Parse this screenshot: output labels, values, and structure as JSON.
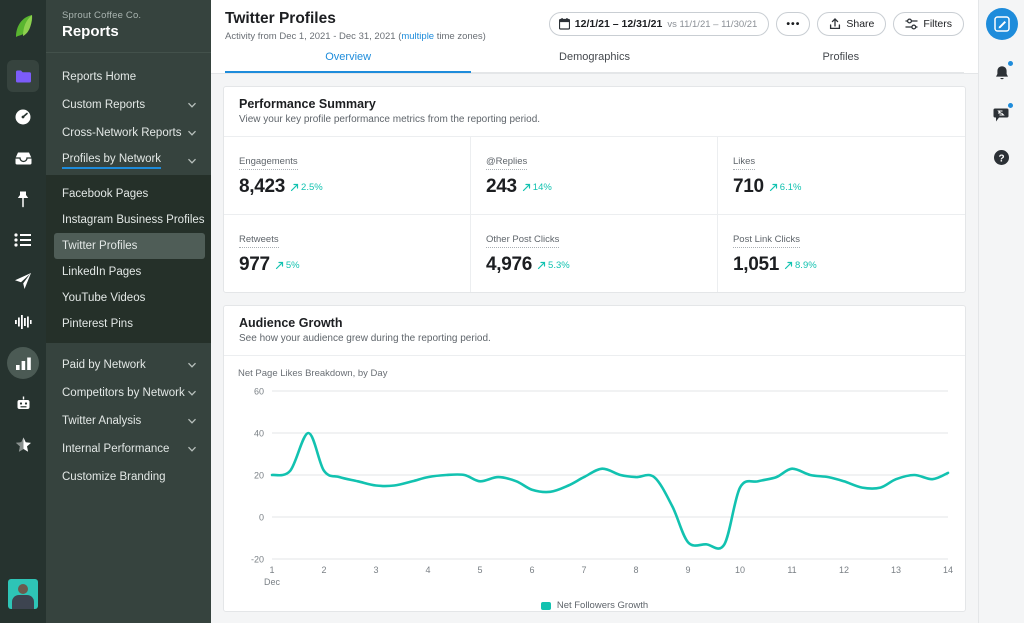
{
  "rail": {
    "logo": "sprout-leaf-logo",
    "icons": [
      {
        "name": "folder-icon",
        "state": "boxed"
      },
      {
        "name": "speedometer-icon",
        "state": "plain"
      },
      {
        "name": "inbox-icon",
        "state": "plain"
      },
      {
        "name": "pin-icon",
        "state": "plain"
      },
      {
        "name": "list-icon",
        "state": "plain"
      },
      {
        "name": "paper-plane-icon",
        "state": "plain"
      },
      {
        "name": "audio-wave-icon",
        "state": "plain"
      },
      {
        "name": "bar-chart-icon",
        "state": "active"
      },
      {
        "name": "robot-icon",
        "state": "plain"
      },
      {
        "name": "star-icon",
        "state": "plain"
      }
    ],
    "avatar": "user-avatar"
  },
  "sidebar": {
    "org": "Sprout Coffee Co.",
    "title": "Reports",
    "items": [
      {
        "label": "Reports Home",
        "expandable": false,
        "active": false
      },
      {
        "label": "Custom Reports",
        "expandable": true,
        "active": false
      },
      {
        "label": "Cross-Network Reports",
        "expandable": true,
        "active": false
      },
      {
        "label": "Profiles by Network",
        "expandable": true,
        "active": true
      }
    ],
    "sub_items": [
      {
        "label": "Facebook Pages",
        "selected": false
      },
      {
        "label": "Instagram Business Profiles",
        "selected": false
      },
      {
        "label": "Twitter Profiles",
        "selected": true
      },
      {
        "label": "LinkedIn Pages",
        "selected": false
      },
      {
        "label": "YouTube Videos",
        "selected": false
      },
      {
        "label": "Pinterest Pins",
        "selected": false
      }
    ],
    "group_items": [
      {
        "label": "Paid by Network",
        "expandable": true
      },
      {
        "label": "Competitors by Network",
        "expandable": true
      },
      {
        "label": "Twitter Analysis",
        "expandable": true
      },
      {
        "label": "Internal Performance",
        "expandable": true
      },
      {
        "label": "Customize Branding",
        "expandable": false
      }
    ]
  },
  "header": {
    "title": "Twitter Profiles",
    "subtitle_prefix": "Activity from Dec 1, 2021 - Dec 31, 2021 (",
    "subtitle_link": "multiple",
    "subtitle_suffix": " time zones)",
    "date_range": "12/1/21 – 12/31/21",
    "date_compare": "vs 11/1/21 – 11/30/21",
    "more_label": "•••",
    "share_label": "Share",
    "filters_label": "Filters"
  },
  "tabs": [
    {
      "label": "Overview",
      "active": true
    },
    {
      "label": "Demographics",
      "active": false
    },
    {
      "label": "Profiles",
      "active": false
    }
  ],
  "performance": {
    "title": "Performance Summary",
    "description": "View your key profile performance metrics from the reporting period.",
    "metrics": [
      {
        "label": "Engagements",
        "value": "8,423",
        "delta": "2.5%",
        "direction": "up"
      },
      {
        "label": "@Replies",
        "value": "243",
        "delta": "14%",
        "direction": "up"
      },
      {
        "label": "Likes",
        "value": "710",
        "delta": "6.1%",
        "direction": "up"
      },
      {
        "label": "Retweets",
        "value": "977",
        "delta": "5%",
        "direction": "up"
      },
      {
        "label": "Other Post Clicks",
        "value": "4,976",
        "delta": "5.3%",
        "direction": "up"
      },
      {
        "label": "Post Link Clicks",
        "value": "1,051",
        "delta": "8.9%",
        "direction": "up"
      }
    ]
  },
  "audience": {
    "title": "Audience Growth",
    "description": "See how your audience grew during the reporting period.",
    "chart_label": "Net Page Likes Breakdown, by Day"
  },
  "chart_data": {
    "type": "line",
    "title": "Net Page Likes Breakdown, by Day",
    "xlabel": "Dec",
    "ylabel": "",
    "color": "#12c2b0",
    "grid": true,
    "legend_position": "bottom",
    "ylim": [
      -20,
      60
    ],
    "yticks": [
      60,
      40,
      20,
      0,
      -20
    ],
    "xticks": [
      "1",
      "2",
      "3",
      "4",
      "5",
      "6",
      "7",
      "8",
      "9",
      "10",
      "11",
      "12",
      "13",
      "14"
    ],
    "x_axis_note": "Dec",
    "series": [
      {
        "name": "Net Followers Growth",
        "x": [
          1,
          1.35,
          1.7,
          2,
          2.3,
          2.65,
          3,
          3.35,
          3.7,
          4,
          4.35,
          4.7,
          5,
          5.35,
          5.7,
          6,
          6.35,
          6.7,
          7,
          7.35,
          7.7,
          8,
          8.35,
          8.7,
          9,
          9.35,
          9.7,
          10,
          10.35,
          10.7,
          11,
          11.35,
          11.7,
          12,
          12.35,
          12.7,
          13,
          13.35,
          13.7,
          14
        ],
        "values": [
          20,
          22,
          40,
          22,
          19,
          17,
          15,
          15,
          17,
          19,
          20,
          20,
          17,
          19,
          17,
          13,
          12,
          15,
          19,
          23,
          20,
          19,
          19,
          5,
          -12,
          -13,
          -13,
          14,
          17,
          19,
          23,
          20,
          19,
          17,
          14,
          14,
          18,
          20,
          18,
          21
        ]
      }
    ],
    "legend": [
      "Net Followers Growth"
    ]
  },
  "right_rail": {
    "compose": "compose-button",
    "icons": [
      {
        "name": "bell-icon",
        "badge": true
      },
      {
        "name": "message-icon",
        "badge": true
      },
      {
        "name": "help-icon",
        "badge": false
      }
    ]
  }
}
